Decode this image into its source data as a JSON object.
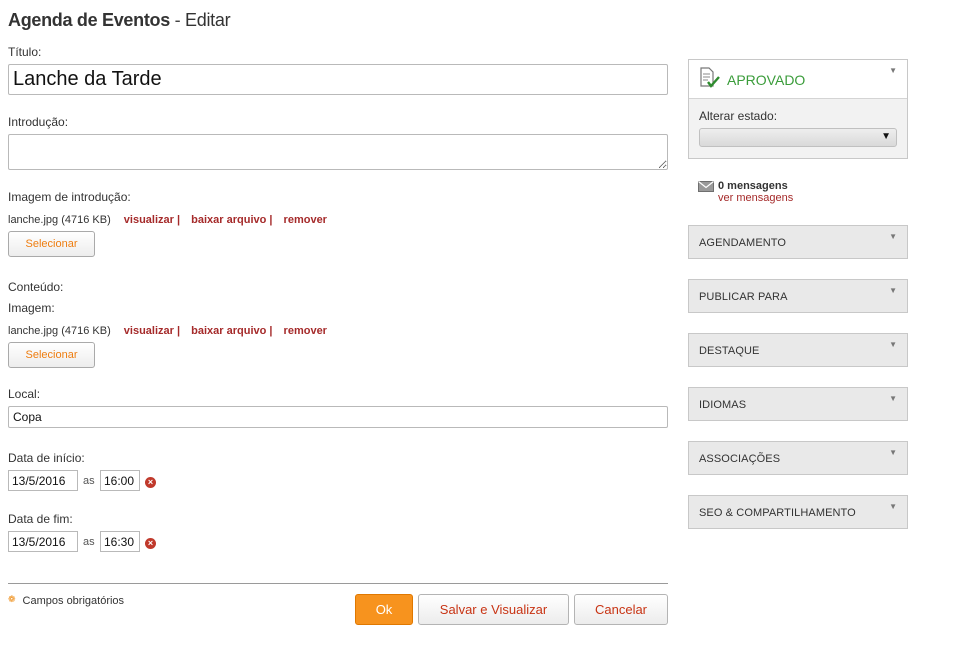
{
  "header": {
    "title": "Agenda de Eventos",
    "separator": "-",
    "subtitle": "Editar"
  },
  "form": {
    "title_label": "Título:",
    "title_value": "Lanche da Tarde",
    "intro_label": "Introdução:",
    "intro_value": "",
    "intro_image_label": "Imagem de introdução:",
    "intro_image": {
      "file": "lanche.jpg (4716 KB)",
      "view": "visualizar |",
      "download": "baixar arquivo |",
      "remove": "remover",
      "select_button": "Selecionar"
    },
    "content_label": "Conteúdo:",
    "image_label": "Imagem:",
    "content_image": {
      "file": "lanche.jpg (4716 KB)",
      "view": "visualizar |",
      "download": "baixar arquivo |",
      "remove": "remover",
      "select_button": "Selecionar"
    },
    "local_label": "Local:",
    "local_value": "Copa",
    "start_label": "Data de início:",
    "start_date": "13/5/2016",
    "start_as": "as",
    "start_time": "16:00",
    "end_label": "Data de fim:",
    "end_date": "13/5/2016",
    "end_as": "as",
    "end_time": "16:30",
    "required_note": "Campos obrigatórios",
    "buttons": {
      "ok": "Ok",
      "save_view": "Salvar e Visualizar",
      "cancel": "Cancelar"
    }
  },
  "sidebar": {
    "status": {
      "label": "APROVADO",
      "change_label": "Alterar estado:",
      "selected": ""
    },
    "messages": {
      "count": "0 mensagens",
      "link": "ver mensagens"
    },
    "sections": [
      {
        "label": "AGENDAMENTO"
      },
      {
        "label": "PUBLICAR PARA"
      },
      {
        "label": "DESTAQUE"
      },
      {
        "label": "IDIOMAS"
      },
      {
        "label": "ASSOCIAÇÕES"
      },
      {
        "label": "SEO & COMPARTILHAMENTO"
      }
    ]
  },
  "icons": {
    "status": "document-check-icon",
    "messages": "envelope-icon",
    "clear": "clear-x-icon",
    "caret": "caret-down-icon",
    "required": "asterisk-icon"
  },
  "colors": {
    "accent": "#f7931e",
    "link": "#a52a2a",
    "approved": "#3a9c3a",
    "button_text": "#c83414",
    "select_text": "#ee7d10",
    "clear": "#c0392b"
  }
}
